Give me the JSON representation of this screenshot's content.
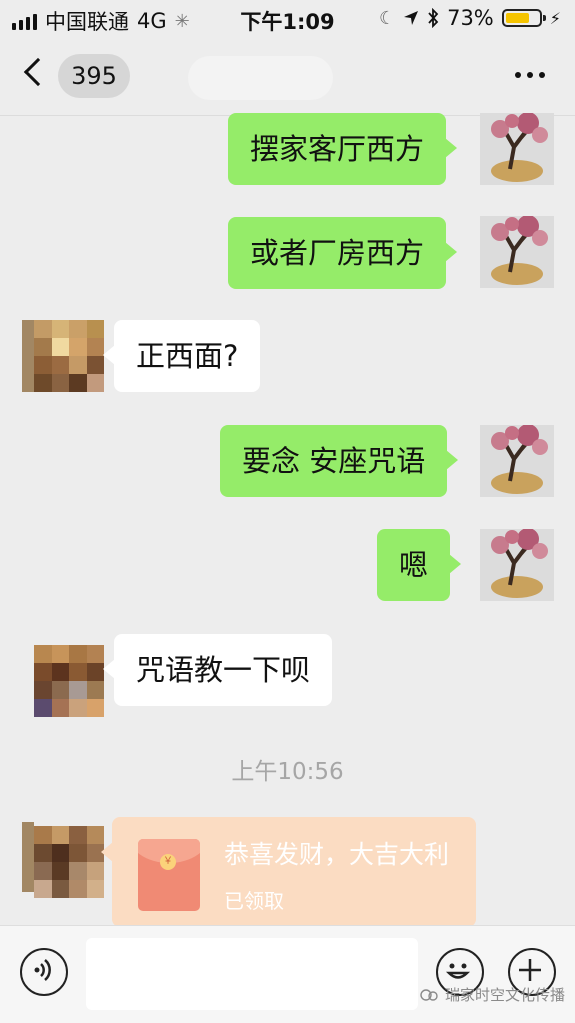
{
  "status_bar": {
    "carrier": "中国联通",
    "network": "4G",
    "time": "下午1:09",
    "battery_percent": "73%",
    "battery_level": 0.73
  },
  "nav": {
    "unread_count": "395"
  },
  "messages": [
    {
      "direction": "out",
      "text": "摆家客厅西方"
    },
    {
      "direction": "out",
      "text": "或者厂房西方"
    },
    {
      "direction": "in",
      "text": "正西面?"
    },
    {
      "direction": "out",
      "text": "要念 安座咒语"
    },
    {
      "direction": "out",
      "text": "嗯"
    },
    {
      "direction": "in",
      "text": "咒语教一下呗"
    }
  ],
  "timestamp": "上午10:56",
  "red_packet": {
    "title": "恭喜发财，大吉大利",
    "status": "已领取"
  },
  "watermark": "瑞家时空文化传播",
  "colors": {
    "background": "#ededed",
    "outgoing_bubble": "#95ec69",
    "incoming_bubble": "#ffffff",
    "red_packet": "#fbdcc2",
    "battery": "#f5c400"
  }
}
